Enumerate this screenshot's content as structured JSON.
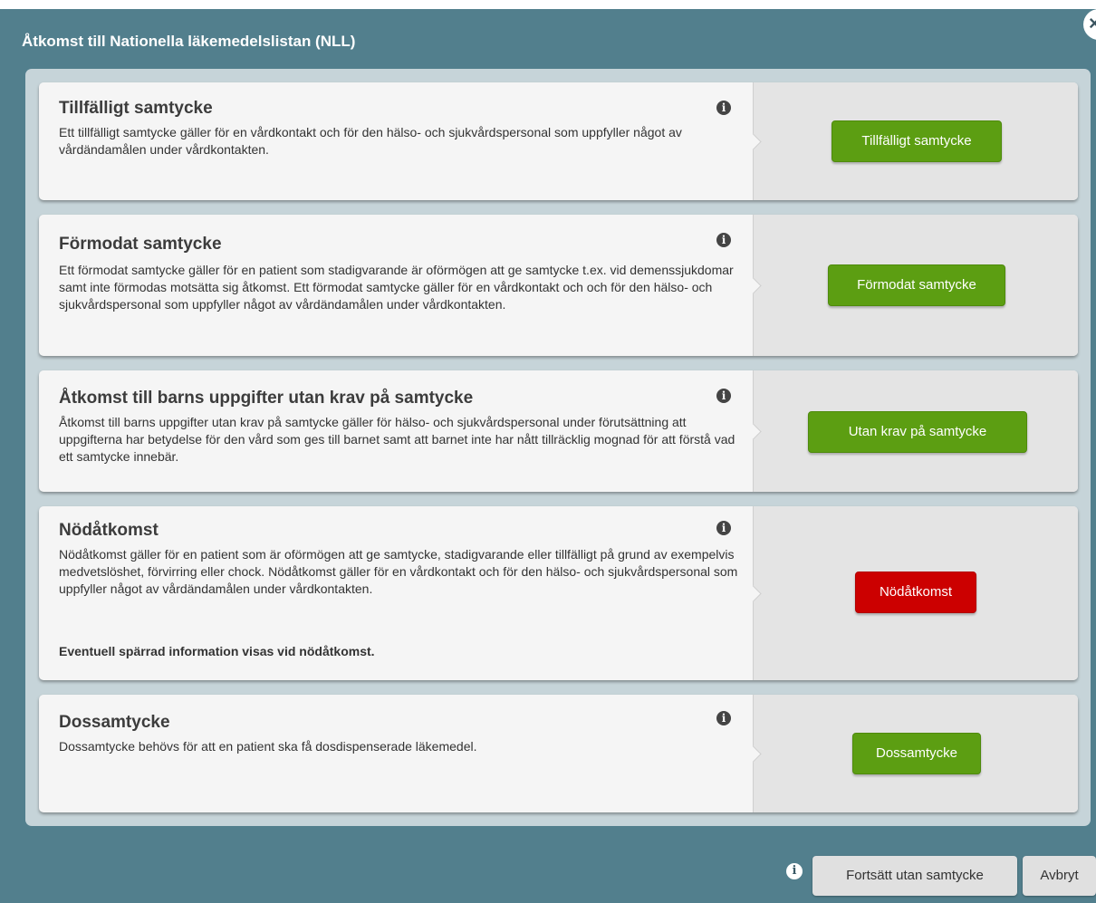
{
  "dialog": {
    "title": "Åtkomst till Nationella läkemedelslistan (NLL)",
    "close_icon": "×"
  },
  "options": [
    {
      "title": "Tillfälligt samtycke",
      "text": "Ett tillfälligt samtycke gäller för en vårdkontakt och för den hälso- och sjukvårdspersonal som uppfyller något av vårdändamålen under vårdkontakten.",
      "note": "",
      "button": "Tillfälligt samtycke",
      "button_color": "#5c9e12"
    },
    {
      "title": "Förmodat samtycke",
      "text": "Ett förmodat samtycke gäller för en patient som stadigvarande är oförmögen att ge samtycke t.ex. vid demenssjukdomar samt inte förmodas motsätta sig åtkomst. Ett förmodat samtycke gäller för en vårdkontakt och och för den hälso- och sjukvårdspersonal som uppfyller något av vårdändamålen under vårdkontakten.",
      "note": "",
      "button": "Förmodat samtycke",
      "button_color": "#5c9e12"
    },
    {
      "title": "Åtkomst till barns uppgifter utan krav på samtycke",
      "text": "Åtkomst till barns uppgifter utan krav på samtycke gäller för hälso- och sjukvårdspersonal under förutsättning att uppgifterna har betydelse för den vård som ges till barnet samt att barnet inte har nått tillräcklig mognad för att förstå vad ett samtycke innebär.",
      "note": "",
      "button": "Utan krav på samtycke",
      "button_color": "#5c9e12"
    },
    {
      "title": "Nödåtkomst",
      "text": "Nödåtkomst gäller för en patient som är oförmögen att ge samtycke, stadigvarande eller tillfälligt på grund av exempelvis medvetslöshet, förvirring eller chock. Nödåtkomst gäller för en vårdkontakt och för den hälso- och sjukvårdspersonal som uppfyller något av vårdändamålen under vårdkontakten.",
      "note": "Eventuell spärrad information visas vid nödåtkomst.",
      "button": "Nödåtkomst",
      "button_color": "#cc0000"
    },
    {
      "title": "Dossamtycke",
      "text": "Dossamtycke behövs för att en patient ska få dosdispenserade läkemedel.",
      "note": "",
      "button": "Dossamtycke",
      "button_color": "#5c9e12"
    }
  ],
  "info_icon_glyph": "i",
  "footer": {
    "info_icon_glyph": "i",
    "continue_label": "Fortsätt utan samtycke",
    "cancel_label": "Avbryt"
  }
}
